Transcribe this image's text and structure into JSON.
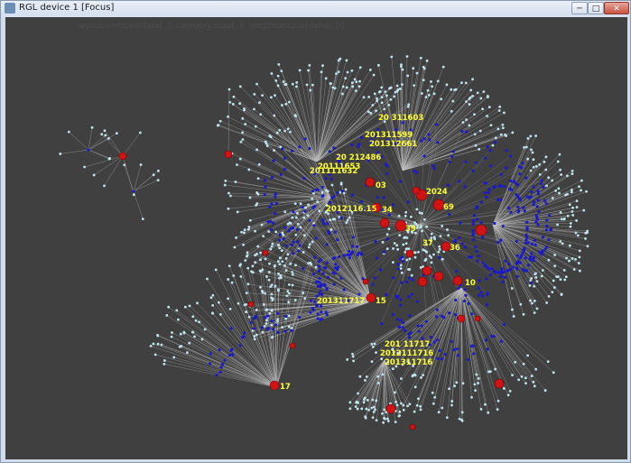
{
  "window": {
    "title": "RGL device 1 [Focus]",
    "minimize_label": "─",
    "maximize_label": "□",
    "close_label": "✕"
  },
  "plot": {
    "header_text": "layout.vertices(data[..], category.map(..), length(unique(data[..]))",
    "colors": {
      "background": "#404040",
      "edge": "#bdbdbd",
      "leaf_node": "#bfe6ef",
      "mid_node": "#1a1acc",
      "hub_node": "#d01414",
      "label": "#ffff33"
    },
    "labels": [
      "20 311603",
      "201311599",
      "201312661",
      "20 212486",
      "20111653",
      "201111632",
      "03",
      "2024",
      "69",
      "2012116.15",
      "34",
      "39",
      "37",
      "36",
      "10",
      "201311717",
      "15",
      "201 11717",
      "2012111716",
      "201311716",
      "17"
    ]
  }
}
